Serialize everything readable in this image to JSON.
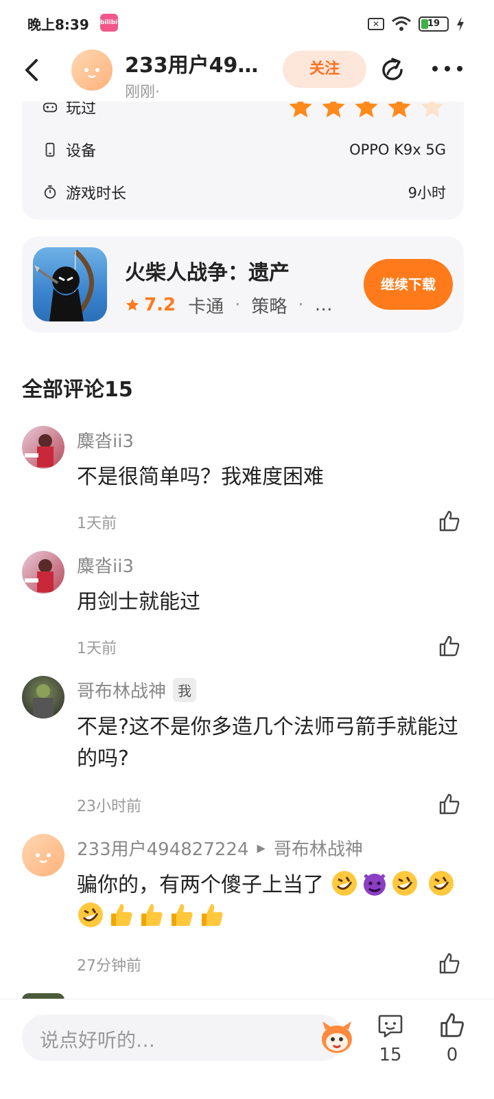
{
  "status": {
    "time": "晚上8:39",
    "app_badge": "bilibili",
    "battery": "19"
  },
  "header": {
    "user_name": "233用户49…",
    "post_time": "刚刚·",
    "follow_label": "关注"
  },
  "info": {
    "played_label": "玩过",
    "rating_stars": 4,
    "device_label": "设备",
    "device_value": "OPPO K9x 5G",
    "duration_label": "游戏时长",
    "duration_value": "9小时"
  },
  "game": {
    "title": "火柴人战争：遗产",
    "rating": "7.2",
    "tag1": "卡通",
    "tag2": "策略",
    "tag_more": "…",
    "download_label": "继续下载"
  },
  "comments_section": {
    "title": "全部评论15"
  },
  "comments": [
    {
      "name": "麋沓ii3",
      "text": "不是很简单吗？我难度困难",
      "time": "1天前"
    },
    {
      "name": "麋沓ii3",
      "text": "用剑士就能过",
      "time": "1天前"
    },
    {
      "name": "哥布林战神",
      "badge": "我",
      "text": "不是?这不是你多造几个法师弓箭手就能过的吗?",
      "time": "23小时前"
    },
    {
      "name": "233用户494827224",
      "reply_to": "哥布林战神",
      "text": "骗你的，有两个傻子上当了",
      "time": "27分钟前"
    }
  ],
  "colors": {
    "accent": "#ff7a1a",
    "follow_bg": "#fde6da",
    "card_bg": "#f6f6f8"
  },
  "bottom_bar": {
    "input_placeholder": "说点好听的…",
    "comment_count": "15",
    "like_count": "0"
  }
}
